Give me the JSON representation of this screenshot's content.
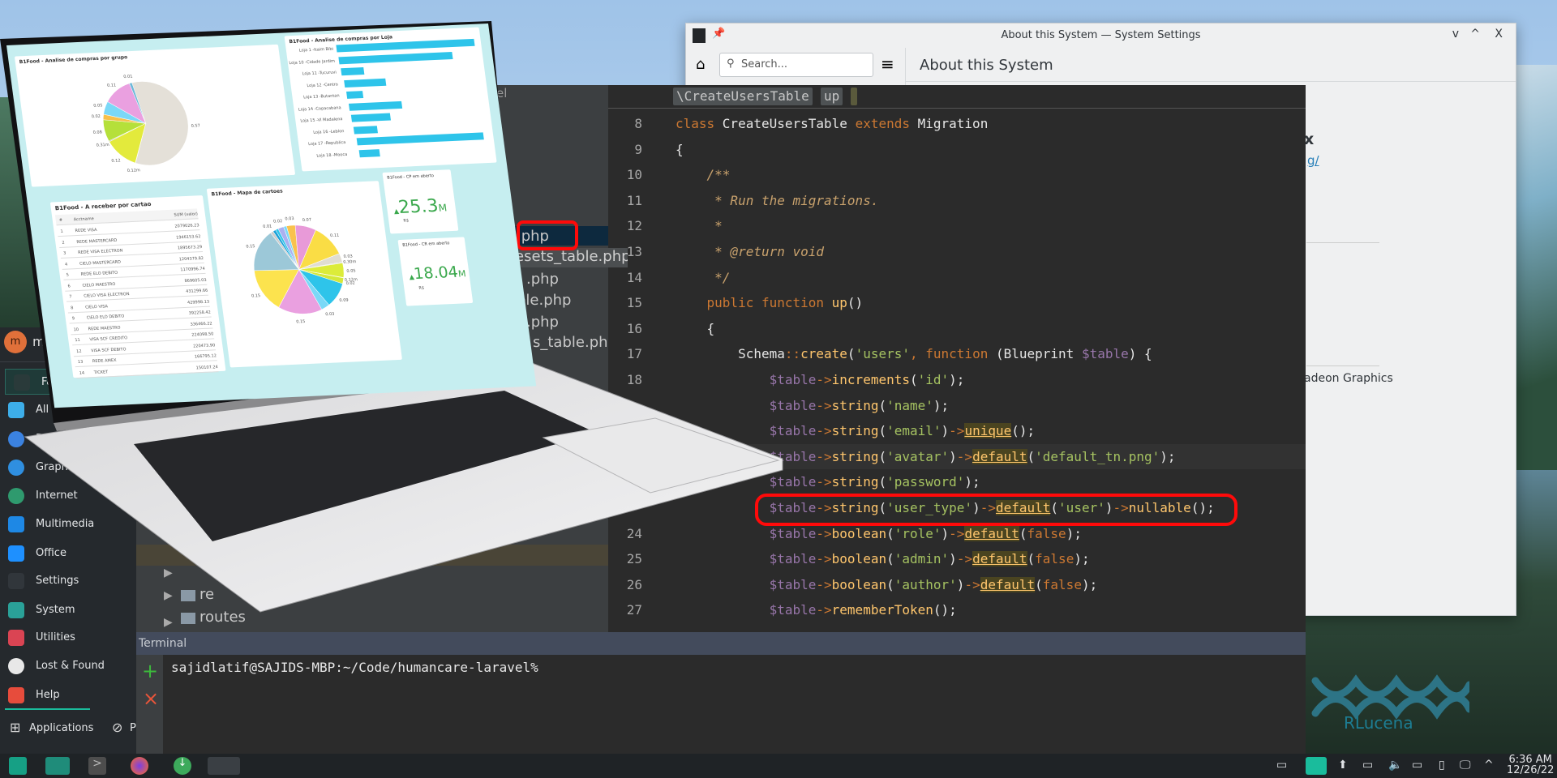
{
  "settings_window": {
    "title": "About this System — System Settings",
    "search_placeholder": "Search...",
    "page_title": "About this System",
    "visible_heading_fragment": "x",
    "visible_link_fragment": "g/",
    "visible_gpu_fragment": "adeon Graphics",
    "controls": {
      "minimize": "v",
      "maximize": "^",
      "close": "X"
    }
  },
  "ide": {
    "tree_title_fragment": "el",
    "tree_rows": [
      ".php",
      "esets_table.php",
      ".php",
      "ble.php",
      ".php",
      "s_table.php"
    ],
    "folders": [
      "re",
      "routes"
    ],
    "breadcrumb": [
      "\\CreateUsersTable",
      "up"
    ],
    "code_lines": [
      {
        "n": "8",
        "t": [
          [
            "k",
            "class "
          ],
          [
            "p",
            "CreateUsersTable "
          ],
          [
            "k",
            "extends "
          ],
          [
            "p",
            "Migration"
          ]
        ]
      },
      {
        "n": "9",
        "t": [
          [
            "p",
            "{"
          ]
        ]
      },
      {
        "n": "10",
        "t": [
          [
            "c",
            "    /**"
          ]
        ]
      },
      {
        "n": "11",
        "t": [
          [
            "c",
            "     * Run the migrations."
          ]
        ]
      },
      {
        "n": "12",
        "t": [
          [
            "c",
            "     *"
          ]
        ]
      },
      {
        "n": "13",
        "t": [
          [
            "c",
            "     * @return void"
          ]
        ]
      },
      {
        "n": "14",
        "t": [
          [
            "c",
            "     */"
          ]
        ]
      },
      {
        "n": "15",
        "t": [
          [
            "k",
            "    public function "
          ],
          [
            "f",
            "up"
          ],
          [
            "p",
            "()"
          ]
        ]
      },
      {
        "n": "16",
        "t": [
          [
            "p",
            "    {"
          ]
        ]
      },
      {
        "n": "17",
        "t": [
          [
            "p",
            "        Schema"
          ],
          [
            "k",
            "::"
          ],
          [
            "f",
            "create"
          ],
          [
            "p",
            "("
          ],
          [
            "s",
            "'users'"
          ],
          [
            "k",
            ", function "
          ],
          [
            "p",
            "(Blueprint "
          ],
          [
            "v",
            "$table"
          ],
          [
            "p",
            ") {"
          ]
        ]
      },
      {
        "n": "18",
        "t": [
          [
            "v",
            "            $table"
          ],
          [
            "k",
            "->"
          ],
          [
            "f",
            "increments"
          ],
          [
            "p",
            "("
          ],
          [
            "s",
            "'id'"
          ],
          [
            "p",
            ");"
          ]
        ]
      },
      {
        "n": "",
        "t": [
          [
            "v",
            "            $table"
          ],
          [
            "k",
            "->"
          ],
          [
            "f",
            "string"
          ],
          [
            "p",
            "("
          ],
          [
            "s",
            "'name'"
          ],
          [
            "p",
            ");"
          ]
        ]
      },
      {
        "n": "",
        "t": [
          [
            "v",
            "            $table"
          ],
          [
            "k",
            "->"
          ],
          [
            "f",
            "string"
          ],
          [
            "p",
            "("
          ],
          [
            "s",
            "'email'"
          ],
          [
            "p",
            ")"
          ],
          [
            "k",
            "->"
          ],
          [
            "h",
            "unique"
          ],
          [
            "p",
            "();"
          ]
        ]
      },
      {
        "n": "",
        "t": [
          [
            "v",
            "            $table"
          ],
          [
            "k",
            "->"
          ],
          [
            "f",
            "string"
          ],
          [
            "p",
            "("
          ],
          [
            "s",
            "'avatar'"
          ],
          [
            "p",
            ")"
          ],
          [
            "k",
            "->"
          ],
          [
            "h",
            "default"
          ],
          [
            "p",
            "("
          ],
          [
            "s",
            "'default_tn.png'"
          ],
          [
            "p",
            ");"
          ]
        ]
      },
      {
        "n": "",
        "t": [
          [
            "v",
            "            $table"
          ],
          [
            "k",
            "->"
          ],
          [
            "f",
            "string"
          ],
          [
            "p",
            "("
          ],
          [
            "s",
            "'password'"
          ],
          [
            "p",
            ");"
          ]
        ]
      },
      {
        "n": "",
        "t": [
          [
            "v",
            "            $table"
          ],
          [
            "k",
            "->"
          ],
          [
            "f",
            "string"
          ],
          [
            "p",
            "("
          ],
          [
            "s",
            "'user_type'"
          ],
          [
            "p",
            ")"
          ],
          [
            "k",
            "->"
          ],
          [
            "h",
            "default"
          ],
          [
            "p",
            "("
          ],
          [
            "s",
            "'user'"
          ],
          [
            "p",
            ")"
          ],
          [
            "k",
            "->"
          ],
          [
            "f",
            "nullable"
          ],
          [
            "p",
            "();"
          ]
        ]
      },
      {
        "n": "24",
        "t": [
          [
            "v",
            "            $table"
          ],
          [
            "k",
            "->"
          ],
          [
            "f",
            "boolean"
          ],
          [
            "p",
            "("
          ],
          [
            "s",
            "'role'"
          ],
          [
            "p",
            ")"
          ],
          [
            "k",
            "->"
          ],
          [
            "h",
            "default"
          ],
          [
            "p",
            "("
          ],
          [
            "k",
            "false"
          ],
          [
            "p",
            ");"
          ]
        ]
      },
      {
        "n": "25",
        "t": [
          [
            "v",
            "            $table"
          ],
          [
            "k",
            "->"
          ],
          [
            "f",
            "boolean"
          ],
          [
            "p",
            "("
          ],
          [
            "s",
            "'admin'"
          ],
          [
            "p",
            ")"
          ],
          [
            "k",
            "->"
          ],
          [
            "h",
            "default"
          ],
          [
            "p",
            "("
          ],
          [
            "k",
            "false"
          ],
          [
            "p",
            ");"
          ]
        ]
      },
      {
        "n": "26",
        "t": [
          [
            "v",
            "            $table"
          ],
          [
            "k",
            "->"
          ],
          [
            "f",
            "boolean"
          ],
          [
            "p",
            "("
          ],
          [
            "s",
            "'author'"
          ],
          [
            "p",
            ")"
          ],
          [
            "k",
            "->"
          ],
          [
            "h",
            "default"
          ],
          [
            "p",
            "("
          ],
          [
            "k",
            "false"
          ],
          [
            "p",
            ");"
          ]
        ]
      },
      {
        "n": "27",
        "t": [
          [
            "v",
            "            $table"
          ],
          [
            "k",
            "->"
          ],
          [
            "f",
            "rememberToken"
          ],
          [
            "p",
            "();"
          ]
        ]
      }
    ]
  },
  "terminal": {
    "title": "Terminal",
    "prompt": "sajidlatif@SAJIDS-MBP:~/Code/humancare-laravel%",
    "add_icon": "+",
    "close_icon": "×"
  },
  "menu": {
    "user_initial": "m",
    "user_fragment": "m",
    "items": [
      {
        "label": "Fa",
        "icon": "bookmark-icon",
        "color": "#2a3a3a"
      },
      {
        "label": "All",
        "icon": "grid-icon",
        "color": "#3daee9"
      },
      {
        "label": "Dev",
        "icon": "development-icon",
        "color": "#3b82e0"
      },
      {
        "label": "Graphic",
        "icon": "graphics-icon",
        "color": "#2f8fe0"
      },
      {
        "label": "Internet",
        "icon": "globe-icon",
        "color": "#2f9a6e"
      },
      {
        "label": "Multimedia",
        "icon": "multimedia-icon",
        "color": "#1e88e5"
      },
      {
        "label": "Office",
        "icon": "office-icon",
        "color": "#1e90ff"
      },
      {
        "label": "Settings",
        "icon": "settings-icon",
        "color": "#31363b"
      },
      {
        "label": "System",
        "icon": "system-icon",
        "color": "#2aa198"
      },
      {
        "label": "Utilities",
        "icon": "toolbox-icon",
        "color": "#da4453"
      },
      {
        "label": "Lost & Found",
        "icon": "ellipsis-icon",
        "color": "#e8e8e8"
      },
      {
        "label": "Help",
        "icon": "lifebuoy-icon",
        "color": "#e74c3c"
      }
    ],
    "footer": {
      "applications": "Applications",
      "places_fragment": "P"
    }
  },
  "taskbar": {
    "clock_time": "6:36 AM",
    "clock_date": "12/26/22",
    "watermark": "RLucena"
  },
  "dashboard": {
    "pie1": {
      "title": "B1Food - Analise de compras por grupo",
      "values": [
        0.57,
        0.0012,
        0.12,
        0.0031,
        0.08,
        0.02,
        0.05,
        0.11,
        0.01
      ],
      "labels": [
        "0.57",
        "0.12m",
        "0.12",
        "0.31m",
        "0.08",
        "0.02",
        "0.05",
        "0.11",
        "0.01"
      ],
      "colors": [
        "#e4e0d8",
        "#aaaaaa",
        "#e3ea3c",
        "#999",
        "#b5e03a",
        "#f7c04a",
        "#7ad8f7",
        "#eaa0e0",
        "#6cb8d8"
      ]
    },
    "bars": {
      "title": "B1Food - Analise de compras por Loja",
      "categories": [
        "Loja 1 -Itaim Bibi",
        "Loja 10 -Cidade Jardim",
        "Loja 11 -Tucuruvi",
        "Loja 12 -Centro",
        "Loja 13 -Butantan",
        "Loja 14 -Copacabana",
        "Loja 15 -Vl Madalena",
        "Loja 16 -Leblon",
        "Loja 17 -Republica",
        "Loja 18 -Mooca"
      ],
      "values": [
        100,
        82,
        16,
        30,
        12,
        38,
        28,
        17,
        92,
        15
      ],
      "color": "#2ec4ea"
    },
    "table": {
      "title": "B1Food - A receber por cartao",
      "headers": [
        "#",
        "Acctname",
        "SUM (valor)"
      ],
      "rows": [
        [
          "1",
          "REDE VISA",
          "2079026.23"
        ],
        [
          "2",
          "REDE MASTERCARD",
          "1946153.62"
        ],
        [
          "3",
          "REDE VISA ELECTRON",
          "1895673.29"
        ],
        [
          "4",
          "CIELO MASTERCARD",
          "1204379.82"
        ],
        [
          "5",
          "REDE ELO DEBITO",
          "1170996.74"
        ],
        [
          "6",
          "CIELO MAESTRO",
          "869605.03"
        ],
        [
          "7",
          "CIELO VISA ELECTRON",
          "431299.66"
        ],
        [
          "8",
          "CIELO VISA",
          "429998.13"
        ],
        [
          "9",
          "CIELO ELO DEBITO",
          "392258.42"
        ],
        [
          "10",
          "REDE MAESTRO",
          "336466.22"
        ],
        [
          "11",
          "VISA SCF CREDITO",
          "224098.50"
        ],
        [
          "12",
          "VISA SCF DEBITO",
          "220473.90"
        ],
        [
          "13",
          "REDE AMEX",
          "166795.12"
        ],
        [
          "14",
          "TICKET",
          "150107.24"
        ]
      ]
    },
    "pie2": {
      "title": "B1Food - Mapa de cartoes",
      "values": [
        0.03,
        0.07,
        0.11,
        0.03,
        0.003,
        0.05,
        0.0012,
        0.02,
        0.09,
        0.03,
        0.15,
        0.15,
        0.15,
        0.01,
        0.01,
        0.01,
        0.02,
        0.01
      ],
      "labels": [
        "0.03",
        "0.07",
        "0.11",
        "0.03",
        "0.30m",
        "0.05",
        "0.12m",
        "0.02",
        "0.09",
        "0.03",
        "0.15",
        "0.15",
        "0.15",
        "0.01",
        "",
        "",
        "0.02",
        ""
      ],
      "colors": [
        "#f9c24d",
        "#e89ad8",
        "#fadd45",
        "#e0ddd2",
        "#ccc",
        "#dcec3a",
        "#ccc",
        "#d4e83a",
        "#2ec4ea",
        "#7ad8f7",
        "#eaa0e0",
        "#fce34e",
        "#9cc8d8",
        "#ccc",
        "#1aa0d8",
        "#2ec4ea",
        "#aab0f0",
        "#7ad8f7"
      ]
    },
    "kpi1": {
      "title": "B1Food - CP em aberto",
      "value": "25.3",
      "unit": "M",
      "currency": "R$"
    },
    "kpi2": {
      "title": "B1Food - CR em aberto",
      "value": "18.04",
      "unit": "M",
      "currency": "R$"
    }
  }
}
